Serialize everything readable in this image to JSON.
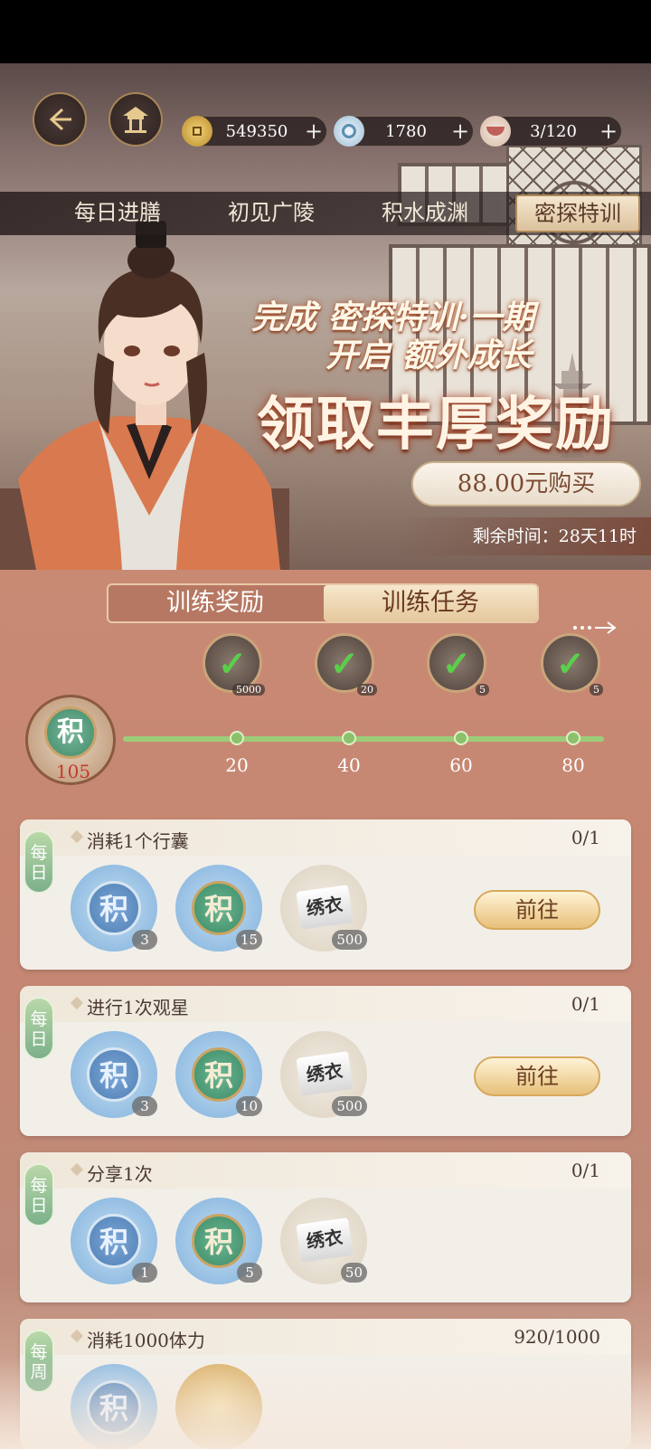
{
  "resources": {
    "coins": "549350",
    "jade": "1780",
    "stamina": "3/120"
  },
  "top_tabs": [
    "每日进膳",
    "初见广陵",
    "积水成渊",
    "密探特训"
  ],
  "banner": {
    "line1": "完成 密探特训·一期",
    "line2": "开启 额外成长",
    "headline": "领取丰厚奖励",
    "buy_label": "88.00元购买",
    "timer": "剩余时间：28天11时"
  },
  "sub_tabs": [
    "训练奖励",
    "训练任务"
  ],
  "progress": {
    "points": "105",
    "milestones": [
      {
        "label": "20",
        "count": "5000"
      },
      {
        "label": "40",
        "count": "20"
      },
      {
        "label": "60",
        "count": "5"
      },
      {
        "label": "80",
        "count": "5"
      }
    ]
  },
  "tasks": [
    {
      "badge": "每日",
      "title": "消耗1个行囊",
      "progress": "0/1",
      "rewards": [
        "3",
        "15",
        "500"
      ],
      "button": "前往"
    },
    {
      "badge": "每日",
      "title": "进行1次观星",
      "progress": "0/1",
      "rewards": [
        "3",
        "10",
        "500"
      ],
      "button": "前往"
    },
    {
      "badge": "每日",
      "title": "分享1次",
      "progress": "0/1",
      "rewards": [
        "1",
        "5",
        "50"
      ],
      "button": ""
    },
    {
      "badge": "每周",
      "title": "消耗1000体力",
      "progress": "920/1000",
      "rewards": [],
      "button": ""
    }
  ],
  "item_glyphs": {
    "jifen": "积",
    "scroll": "绣衣"
  }
}
